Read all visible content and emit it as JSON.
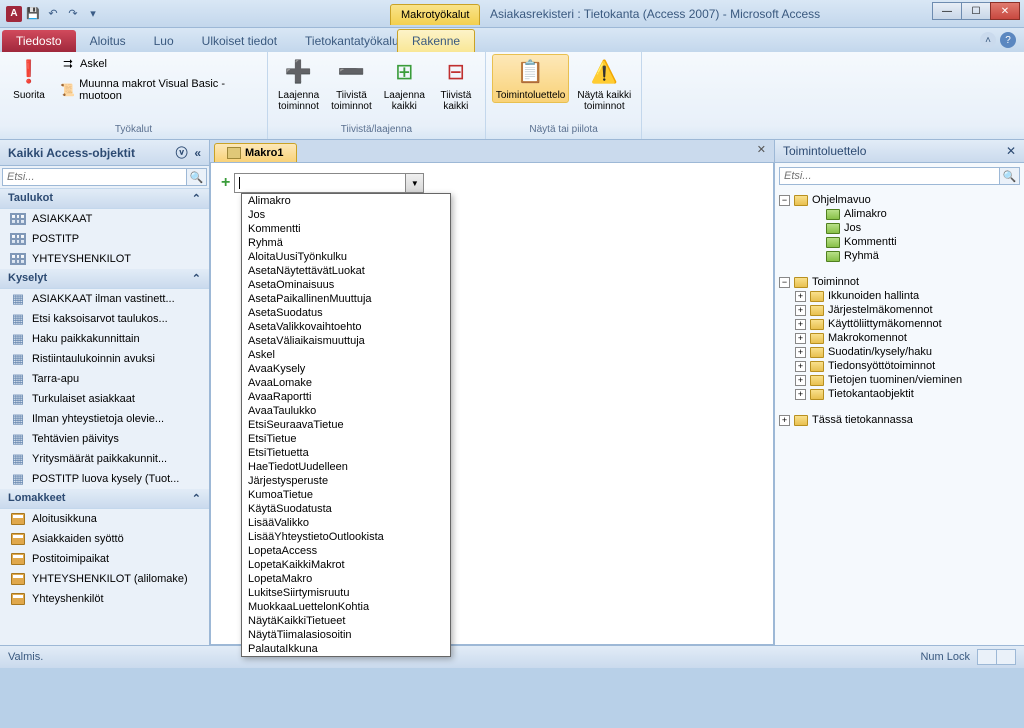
{
  "window": {
    "contextual_tab_group": "Makrotyökalut",
    "title": "Asiakasrekisteri : Tietokanta (Access 2007)  -  Microsoft Access"
  },
  "tabs": {
    "file": "Tiedosto",
    "home": "Aloitus",
    "create": "Luo",
    "external": "Ulkoiset tiedot",
    "dbtools": "Tietokantatyökalut",
    "design": "Rakenne"
  },
  "ribbon": {
    "tools": {
      "run": "Suorita",
      "step": "Askel",
      "convert": "Muunna makrot Visual Basic -muotoon",
      "group": "Työkalut"
    },
    "collapse": {
      "expand_actions": "Laajenna\ntoiminnot",
      "collapse_actions": "Tiivistä\ntoiminnot",
      "expand_all": "Laajenna\nkaikki",
      "collapse_all": "Tiivistä\nkaikki",
      "group": "Tiivistä/laajenna"
    },
    "showhide": {
      "action_catalog": "Toimintoluettelo",
      "show_all": "Näytä kaikki\ntoiminnot",
      "group": "Näytä tai piilota"
    }
  },
  "nav": {
    "title": "Kaikki Access-objektit",
    "search_placeholder": "Etsi...",
    "groups": {
      "tables": "Taulukot",
      "queries": "Kyselyt",
      "forms": "Lomakkeet"
    },
    "tables": [
      "ASIAKKAAT",
      "POSTITP",
      "YHTEYSHENKILOT"
    ],
    "queries": [
      "ASIAKKAAT ilman vastinett...",
      "Etsi kaksoisarvot taulukos...",
      "Haku paikkakunnittain",
      "Ristiintaulukoinnin avuksi",
      "Tarra-apu",
      "Turkulaiset asiakkaat",
      "Ilman yhteystietoja olevie...",
      "Tehtävien päivitys",
      "Yritysmäärät paikkakunnit...",
      "POSTITP luova kysely (Tuot..."
    ],
    "forms": [
      "Aloitusikkuna",
      "Asiakkaiden syöttö",
      "Postitoimipaikat",
      "YHTEYSHENKILOT (alilomake)",
      "Yhteyshenkilöt"
    ]
  },
  "doc": {
    "tab_title": "Makro1",
    "dropdown": [
      "Alimakro",
      "Jos",
      "Kommentti",
      "Ryhmä",
      "AloitaUusiTyönkulku",
      "AsetaNäytettävätLuokat",
      "AsetaOminaisuus",
      "AsetaPaikallinenMuuttuja",
      "AsetaSuodatus",
      "AsetaValikkovaihtoehto",
      "AsetaVäliaikaismuuttuja",
      "Askel",
      "AvaaKysely",
      "AvaaLomake",
      "AvaaRaportti",
      "AvaaTaulukko",
      "EtsiSeuraavaTietue",
      "EtsiTietue",
      "EtsiTietuetta",
      "HaeTiedotUudelleen",
      "Järjestysperuste",
      "KumoaTietue",
      "KäytäSuodatusta",
      "LisääValikko",
      "LisääYhteystietoOutlookista",
      "LopetaAccess",
      "LopetaKaikkiMakrot",
      "LopetaMakro",
      "LukitseSiirtymisruutu",
      "MuokkaaLuettelonKohtia",
      "NäytäKaikkiTietueet",
      "NäytäTiimalasiosoitin",
      "PalautaIkkuna"
    ]
  },
  "catalog": {
    "title": "Toimintoluettelo",
    "search_placeholder": "Etsi...",
    "program_flow": "Ohjelmavuo",
    "pf_items": [
      "Alimakro",
      "Jos",
      "Kommentti",
      "Ryhmä"
    ],
    "actions": "Toiminnot",
    "action_groups": [
      "Ikkunoiden hallinta",
      "Järjestelmäkomennot",
      "Käyttöliittymäkomennot",
      "Makrokomennot",
      "Suodatin/kysely/haku",
      "Tiedonsyöttötoiminnot",
      "Tietojen tuominen/vieminen",
      "Tietokantaobjektit"
    ],
    "in_this_db": "Tässä tietokannassa"
  },
  "status": {
    "ready": "Valmis.",
    "numlock": "Num Lock"
  }
}
